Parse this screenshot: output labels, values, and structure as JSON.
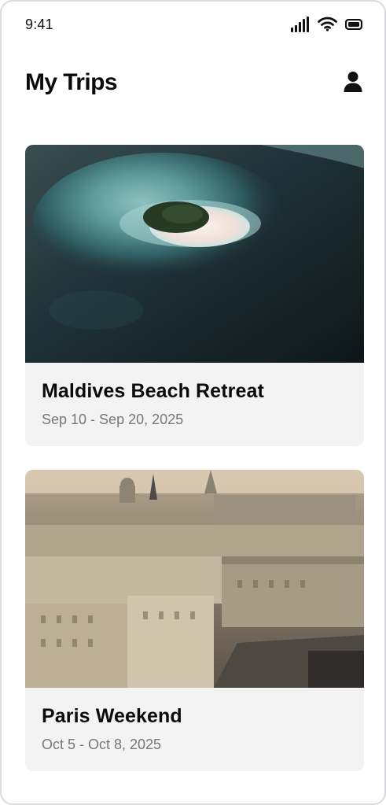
{
  "status_bar": {
    "time": "9:41",
    "icons": [
      "signal-icon",
      "wifi-icon",
      "battery-icon"
    ]
  },
  "header": {
    "title": "My Trips",
    "profile_icon": "user-icon"
  },
  "trips": [
    {
      "title": "Maldives Beach Retreat",
      "dates": "Sep 10 - Sep 20, 2025",
      "image": "aerial-island-photo"
    },
    {
      "title": "Paris Weekend",
      "dates": "Oct 5 - Oct 8, 2025",
      "image": "paris-cityscape-photo"
    }
  ],
  "colors": {
    "background": "#ffffff",
    "card_background": "#f3f3f3",
    "title_text": "#0b0b0b",
    "secondary_text": "#777777",
    "frame_border": "#d9dbe0"
  }
}
